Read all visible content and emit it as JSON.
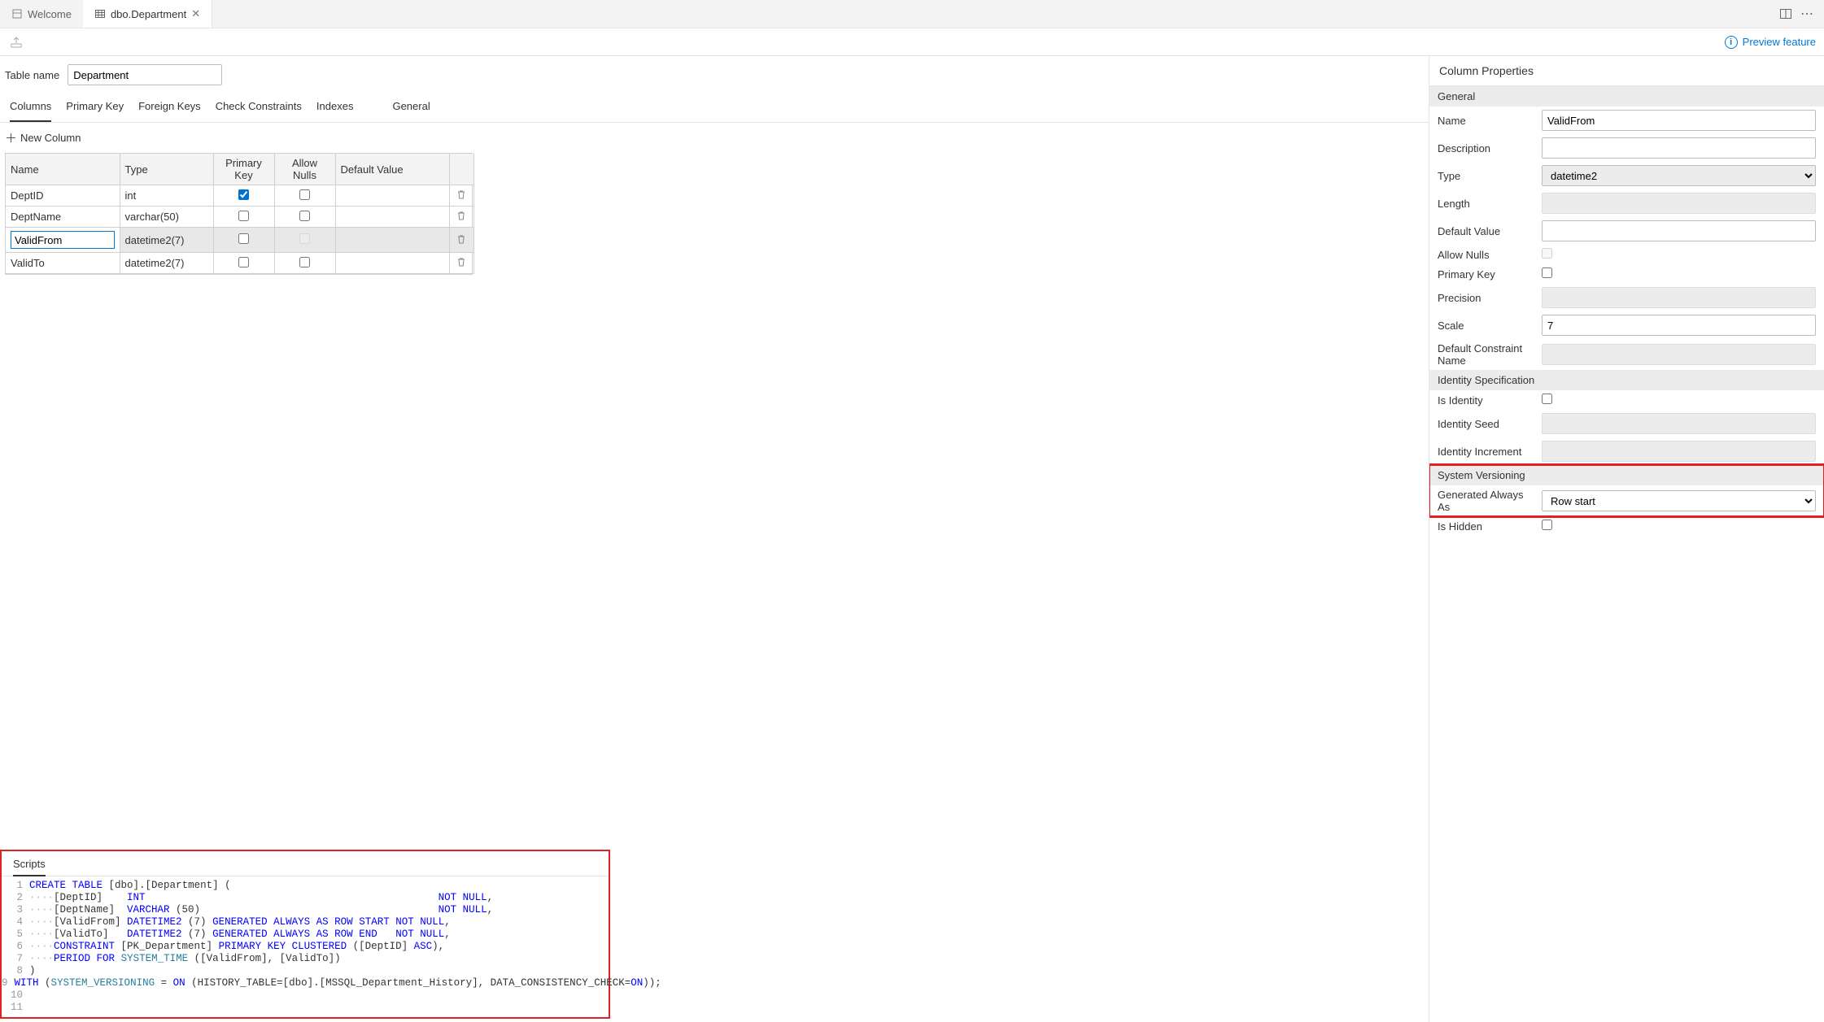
{
  "tabs": {
    "welcome": "Welcome",
    "dbo": "dbo.Department"
  },
  "preview": "Preview feature",
  "table_name_label": "Table name",
  "table_name": "Department",
  "designer_tabs": {
    "columns": "Columns",
    "primary_key": "Primary Key",
    "foreign_keys": "Foreign Keys",
    "check_constraints": "Check Constraints",
    "indexes": "Indexes",
    "general": "General"
  },
  "new_column": "New Column",
  "col_headers": {
    "name": "Name",
    "type": "Type",
    "pk": "Primary Key",
    "nulls": "Allow Nulls",
    "default": "Default Value"
  },
  "rows": [
    {
      "name": "DeptID",
      "type": "int",
      "pk": true,
      "nulls": false
    },
    {
      "name": "DeptName",
      "type": "varchar(50)",
      "pk": false,
      "nulls": false
    },
    {
      "name": "ValidFrom",
      "type": "datetime2(7)",
      "pk": false,
      "nulls": false,
      "nulls_disabled": true,
      "editing": true,
      "selected": true
    },
    {
      "name": "ValidTo",
      "type": "datetime2(7)",
      "pk": false,
      "nulls": false
    }
  ],
  "scripts_title": "Scripts",
  "props": {
    "title": "Column Properties",
    "sections": {
      "general": "General",
      "identity": "Identity Specification",
      "sv": "System Versioning"
    },
    "general": {
      "name_label": "Name",
      "name": "ValidFrom",
      "desc_label": "Description",
      "desc": "",
      "type_label": "Type",
      "type": "datetime2",
      "length_label": "Length",
      "default_label": "Default Value",
      "default": "",
      "nulls_label": "Allow Nulls",
      "nulls": false,
      "pk_label": "Primary Key",
      "pk": false,
      "precision_label": "Precision",
      "scale_label": "Scale",
      "scale": "7",
      "dcn_label": "Default Constraint Name"
    },
    "identity": {
      "is_label": "Is Identity",
      "is": false,
      "seed_label": "Identity Seed",
      "incr_label": "Identity Increment"
    },
    "sv": {
      "gaa_label": "Generated Always As",
      "gaa": "Row start",
      "hidden_label": "Is Hidden",
      "hidden": false
    }
  },
  "chart_data": {
    "type": "table",
    "title": "Department columns",
    "columns": [
      "Name",
      "Type",
      "Primary Key",
      "Allow Nulls",
      "Default Value"
    ],
    "rows": [
      [
        "DeptID",
        "int",
        true,
        false,
        ""
      ],
      [
        "DeptName",
        "varchar(50)",
        false,
        false,
        ""
      ],
      [
        "ValidFrom",
        "datetime2(7)",
        false,
        false,
        ""
      ],
      [
        "ValidTo",
        "datetime2(7)",
        false,
        false,
        ""
      ]
    ]
  },
  "script_lines": [
    "CREATE TABLE [dbo].[Department] (",
    "    [DeptID]    INT                                                NOT NULL,",
    "    [DeptName]  VARCHAR (50)                                       NOT NULL,",
    "    [ValidFrom] DATETIME2 (7) GENERATED ALWAYS AS ROW START NOT NULL,",
    "    [ValidTo]   DATETIME2 (7) GENERATED ALWAYS AS ROW END   NOT NULL,",
    "    CONSTRAINT [PK_Department] PRIMARY KEY CLUSTERED ([DeptID] ASC),",
    "    PERIOD FOR SYSTEM_TIME ([ValidFrom], [ValidTo])",
    ")",
    "WITH (SYSTEM_VERSIONING = ON (HISTORY_TABLE=[dbo].[MSSQL_Department_History], DATA_CONSISTENCY_CHECK=ON));",
    "",
    ""
  ]
}
